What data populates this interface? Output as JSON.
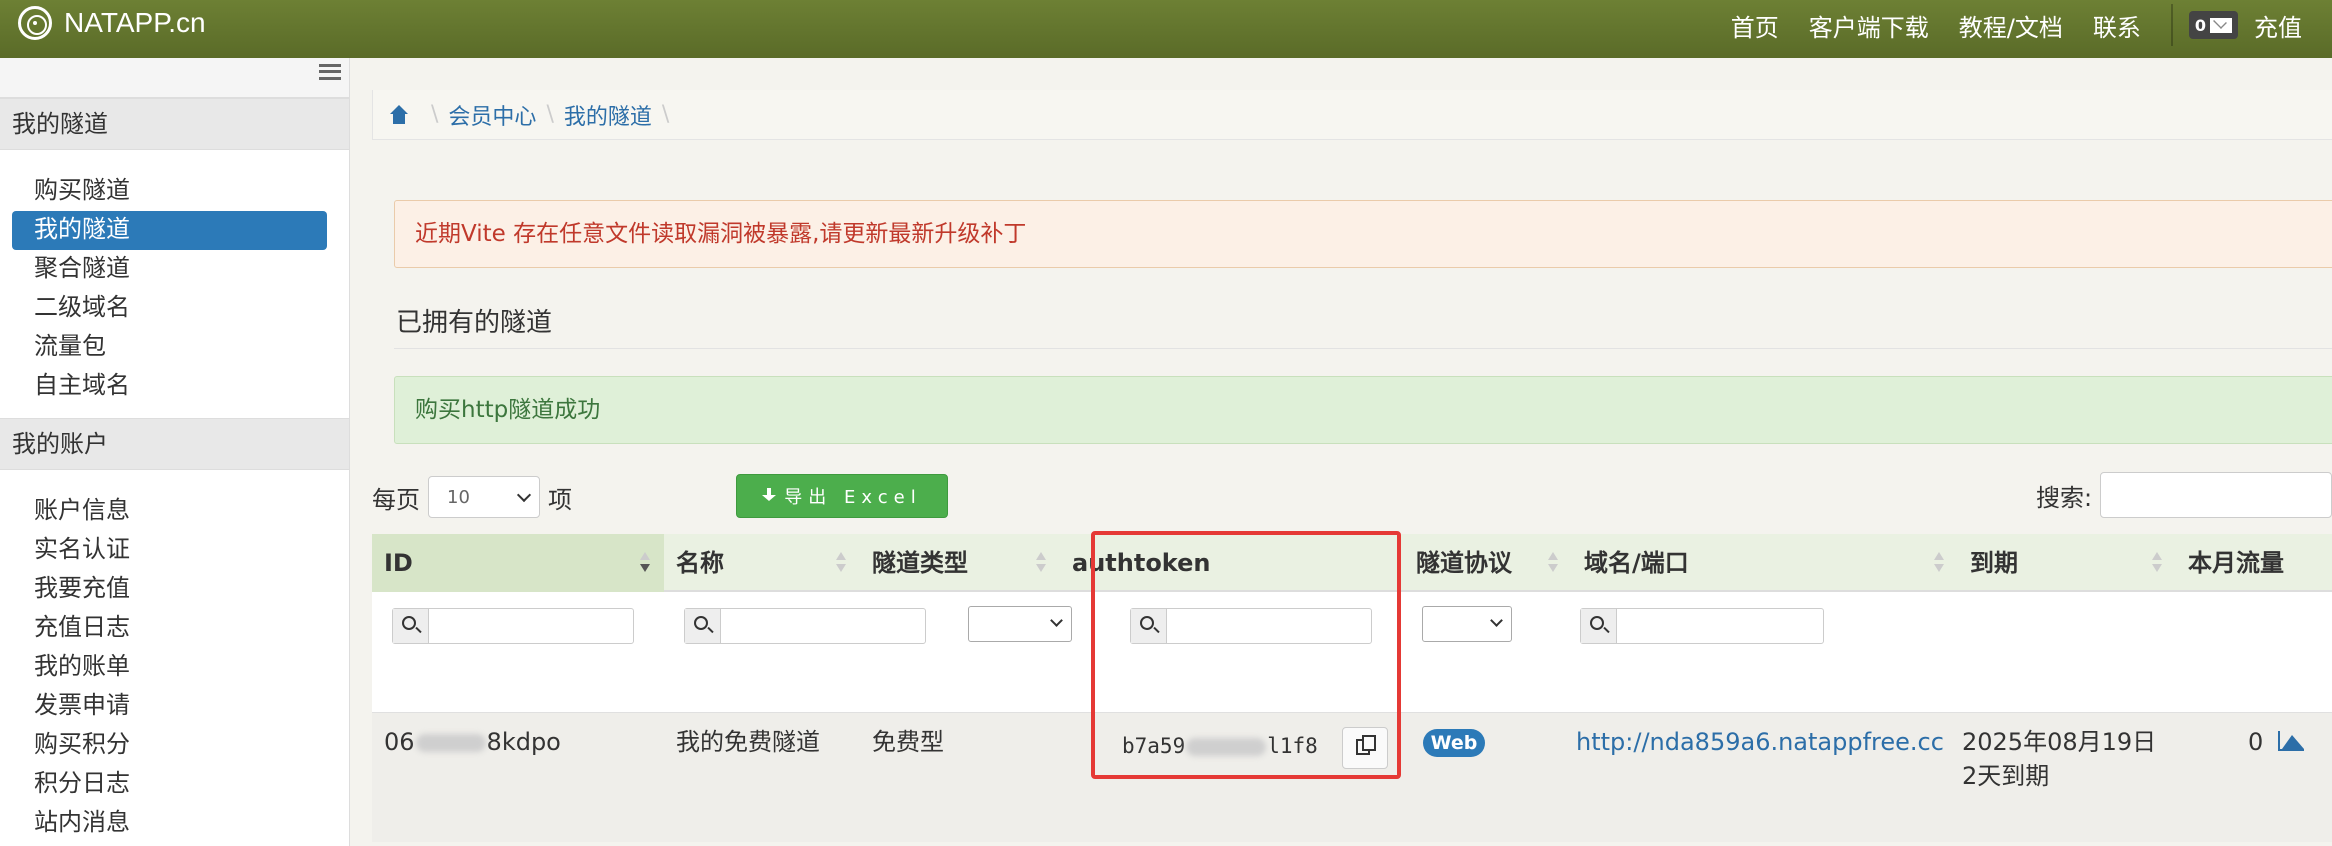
{
  "header": {
    "logo_text": "NATAPP.cn",
    "nav": [
      "首页",
      "客户端下载",
      "教程/文档",
      "联系"
    ],
    "mail_count": "0",
    "recharge": "充值"
  },
  "sidebar": {
    "sections": [
      {
        "title": "我的隧道",
        "items": [
          "购买隧道",
          "我的隧道",
          "聚合隧道",
          "二级域名",
          "流量包",
          "自主域名"
        ],
        "active": 1
      },
      {
        "title": "我的账户",
        "items": [
          "账户信息",
          "实名认证",
          "我要充值",
          "充值日志",
          "我的账单",
          "发票申请",
          "购买积分",
          "积分日志",
          "站内消息"
        ]
      }
    ]
  },
  "breadcrumb": {
    "items": [
      "会员中心",
      "我的隧道"
    ]
  },
  "alerts": {
    "warning": "近期Vite 存在任意文件读取漏洞被暴露,请更新最新升级补丁",
    "success": "购买http隧道成功"
  },
  "section_title": "已拥有的隧道",
  "controls": {
    "per_page_label": "每页",
    "per_page_value": "10",
    "per_page_suffix": "项",
    "export_label": "导出 Excel",
    "search_label": "搜索:"
  },
  "table": {
    "headers": [
      "ID",
      "名称",
      "隧道类型",
      "authtoken",
      "隧道协议",
      "域名/端口",
      "到期",
      "本月流量"
    ],
    "rows": [
      {
        "id_start": "06",
        "id_end": "8kdpo",
        "name": "我的免费隧道",
        "type": "免费型",
        "token_start": "b7a59",
        "token_end": "l1f8",
        "protocol": "Web",
        "domain": "http://nda859a6.natappfree.cc",
        "expire_date": "2025年08月19日",
        "expire_note": "2天到期",
        "traffic": "0"
      }
    ]
  },
  "colors": {
    "header": "#5f7029",
    "active": "#2c7ab8",
    "export": "#4cae4c",
    "highlight": "#e53935"
  }
}
